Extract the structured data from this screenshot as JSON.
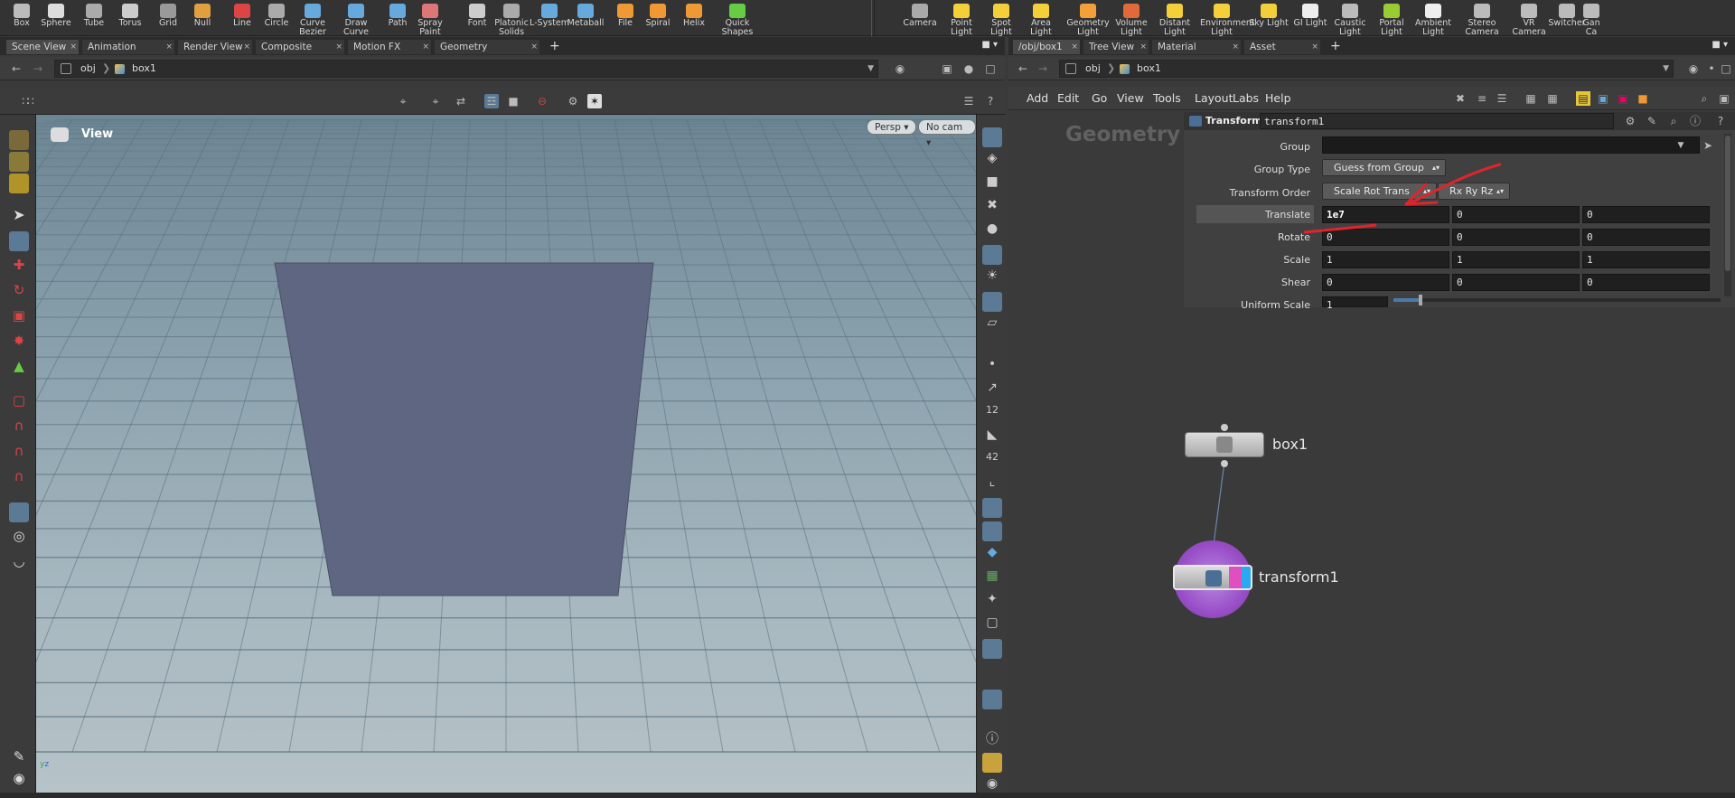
{
  "shelf": {
    "left_tools": [
      {
        "label": "Box",
        "icon": "box-icon"
      },
      {
        "label": "Sphere",
        "icon": "sphere-icon"
      },
      {
        "label": "Tube",
        "icon": "tube-icon"
      },
      {
        "label": "Torus",
        "icon": "torus-icon"
      },
      {
        "label": "Grid",
        "icon": "grid-icon"
      },
      {
        "label": "Null",
        "icon": "null-icon"
      },
      {
        "label": "Line",
        "icon": "line-icon"
      },
      {
        "label": "Circle",
        "icon": "circle-icon"
      },
      {
        "label": "Curve Bezier",
        "icon": "curve-bezier-icon"
      },
      {
        "label": "Draw Curve",
        "icon": "draw-curve-icon"
      },
      {
        "label": "Path",
        "icon": "path-icon"
      },
      {
        "label": "Spray Paint",
        "icon": "spray-paint-icon"
      },
      {
        "label": "Font",
        "icon": "font-icon"
      },
      {
        "label": "Platonic Solids",
        "icon": "platonic-icon"
      },
      {
        "label": "L-System",
        "icon": "lsystem-icon"
      },
      {
        "label": "Metaball",
        "icon": "metaball-icon"
      },
      {
        "label": "File",
        "icon": "file-icon"
      },
      {
        "label": "Spiral",
        "icon": "spiral-icon"
      },
      {
        "label": "Helix",
        "icon": "helix-icon"
      },
      {
        "label": "Quick Shapes",
        "icon": "quick-shapes-icon"
      }
    ],
    "right_tools": [
      {
        "label": "Camera",
        "icon": "camera-icon"
      },
      {
        "label": "Point Light",
        "icon": "point-light-icon"
      },
      {
        "label": "Spot Light",
        "icon": "spot-light-icon"
      },
      {
        "label": "Area Light",
        "icon": "area-light-icon"
      },
      {
        "label": "Geometry Light",
        "icon": "geometry-light-icon"
      },
      {
        "label": "Volume Light",
        "icon": "volume-light-icon"
      },
      {
        "label": "Distant Light",
        "icon": "distant-light-icon"
      },
      {
        "label": "Environment Light",
        "icon": "environment-light-icon"
      },
      {
        "label": "Sky Light",
        "icon": "sky-light-icon"
      },
      {
        "label": "GI Light",
        "icon": "gi-light-icon"
      },
      {
        "label": "Caustic Light",
        "icon": "caustic-light-icon"
      },
      {
        "label": "Portal Light",
        "icon": "portal-light-icon"
      },
      {
        "label": "Ambient Light",
        "icon": "ambient-light-icon"
      },
      {
        "label": "Stereo Camera",
        "icon": "stereo-camera-icon"
      },
      {
        "label": "VR Camera",
        "icon": "vr-camera-icon"
      },
      {
        "label": "Switcher",
        "icon": "switcher-icon"
      },
      {
        "label": "Gan Ca",
        "icon": "gamepad-camera-icon"
      }
    ]
  },
  "left_tabs": [
    "Scene View",
    "Animation Editor",
    "Render View",
    "Composite View",
    "Motion FX View",
    "Geometry Spreadsheet"
  ],
  "right_tabs": [
    "/obj/box1",
    "Tree View",
    "Material Palette",
    "Asset Browser"
  ],
  "left_path": {
    "root": "obj",
    "node": "box1"
  },
  "right_path": {
    "root": "obj",
    "node": "box1"
  },
  "viewport": {
    "title": "View",
    "persp": "Persp",
    "cam": "No cam"
  },
  "network_menu": [
    "Add",
    "Edit",
    "Go",
    "View",
    "Tools",
    "Layout",
    "Labs",
    "Help"
  ],
  "network_label": "Geometry",
  "params": {
    "node_type": "Transform",
    "node_name": "transform1",
    "group_label": "Group",
    "group_value": "",
    "group_type_label": "Group Type",
    "group_type_value": "Guess from Group",
    "transform_order_label": "Transform Order",
    "transform_order_value": "Scale Rot Trans",
    "rot_order_value": "Rx Ry Rz",
    "rows": [
      {
        "label": "Translate",
        "values": [
          "1e7",
          "0",
          "0"
        ]
      },
      {
        "label": "Rotate",
        "values": [
          "0",
          "0",
          "0"
        ]
      },
      {
        "label": "Scale",
        "values": [
          "1",
          "1",
          "1"
        ]
      },
      {
        "label": "Shear",
        "values": [
          "0",
          "0",
          "0"
        ]
      }
    ],
    "uniform_scale_label": "Uniform Scale",
    "uniform_scale_value": "1"
  },
  "nodes": {
    "box": "box1",
    "transform": "transform1"
  },
  "colors": {
    "annotation": "#e0242c",
    "plane": "#5f6682",
    "sky_top": "#6c8593",
    "node_flag_blue": "#2aa8f0",
    "node_flag_pink": "#e04fc0"
  }
}
